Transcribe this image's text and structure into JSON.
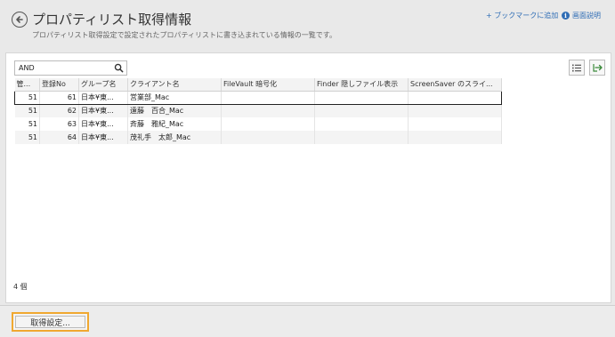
{
  "header": {
    "title": "プロパティリスト取得情報",
    "subtitle": "プロパティリスト取得設定で設定されたプロパティリストに書き込まれている情報の一覧です。",
    "bookmark_label": "+ ブックマークに追加",
    "help_label": "画面説明",
    "help_icon": "i"
  },
  "toolbar": {
    "search_value": "AND",
    "search_icon": "search-icon",
    "list_icon": "list-icon",
    "export_icon": "export-icon"
  },
  "table": {
    "columns": [
      "管...",
      "登録No",
      "グループ名",
      "クライアント名",
      "FileVault 暗号化",
      "Finder 隠しファイル表示",
      "ScreenSaver のスライ..."
    ],
    "rows": [
      {
        "kan": "51",
        "no": "61",
        "group": "日本¥東...",
        "client": "営業部_Mac",
        "fv": "",
        "finder": "",
        "ss": ""
      },
      {
        "kan": "51",
        "no": "62",
        "group": "日本¥東...",
        "client": "遠藤　百合_Mac",
        "fv": "",
        "finder": "",
        "ss": ""
      },
      {
        "kan": "51",
        "no": "63",
        "group": "日本¥東...",
        "client": "斉藤　雅紀_Mac",
        "fv": "",
        "finder": "",
        "ss": ""
      },
      {
        "kan": "51",
        "no": "64",
        "group": "日本¥東...",
        "client": "茂礼手　太郎_Mac",
        "fv": "",
        "finder": "",
        "ss": ""
      }
    ]
  },
  "status": {
    "count": "4 個"
  },
  "footer": {
    "settings_button": "取得設定..."
  },
  "colors": {
    "accent": "#f0a830",
    "link": "#2f6db5"
  }
}
